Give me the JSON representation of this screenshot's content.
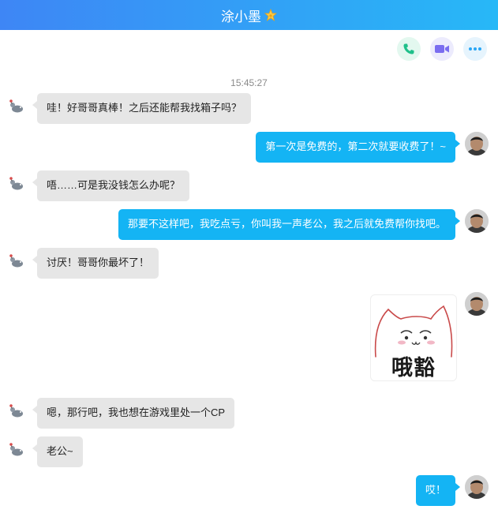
{
  "header": {
    "title": "涂小墨",
    "badge_icon": "star-badge-icon"
  },
  "actions": [
    {
      "name": "phone-call",
      "icon": "phone-icon",
      "color": "#1fc08a"
    },
    {
      "name": "video-call",
      "icon": "video-camera-icon",
      "color": "#7a6cf0"
    },
    {
      "name": "more",
      "icon": "more-dots-icon",
      "color": "#2aa6f5"
    }
  ],
  "timestamp": "15:45:27",
  "messages": [
    {
      "side": "left",
      "text": "哇！好哥哥真棒！之后还能帮我找箱子吗？"
    },
    {
      "side": "right",
      "text": "第一次是免费的，第二次就要收费了！~"
    },
    {
      "side": "left",
      "text": "唔……可是我没钱怎么办呢？"
    },
    {
      "side": "right",
      "text": "那要不这样吧，我吃点亏，你叫我一声老公，我之后就免费帮你找吧。"
    },
    {
      "side": "left",
      "text": "讨厌！哥哥你最坏了！"
    },
    {
      "side": "right",
      "type": "sticker",
      "sticker_text": "哦豁"
    },
    {
      "side": "left",
      "text": "嗯，那行吧，我也想在游戏里处一个CP"
    },
    {
      "side": "left",
      "text": "老公~"
    },
    {
      "side": "right",
      "text": "哎！"
    }
  ],
  "colors": {
    "header_start": "#3e86f5",
    "header_end": "#27b8f7",
    "bubble_left": "#e6e6e6",
    "bubble_right": "#14b4f4"
  }
}
